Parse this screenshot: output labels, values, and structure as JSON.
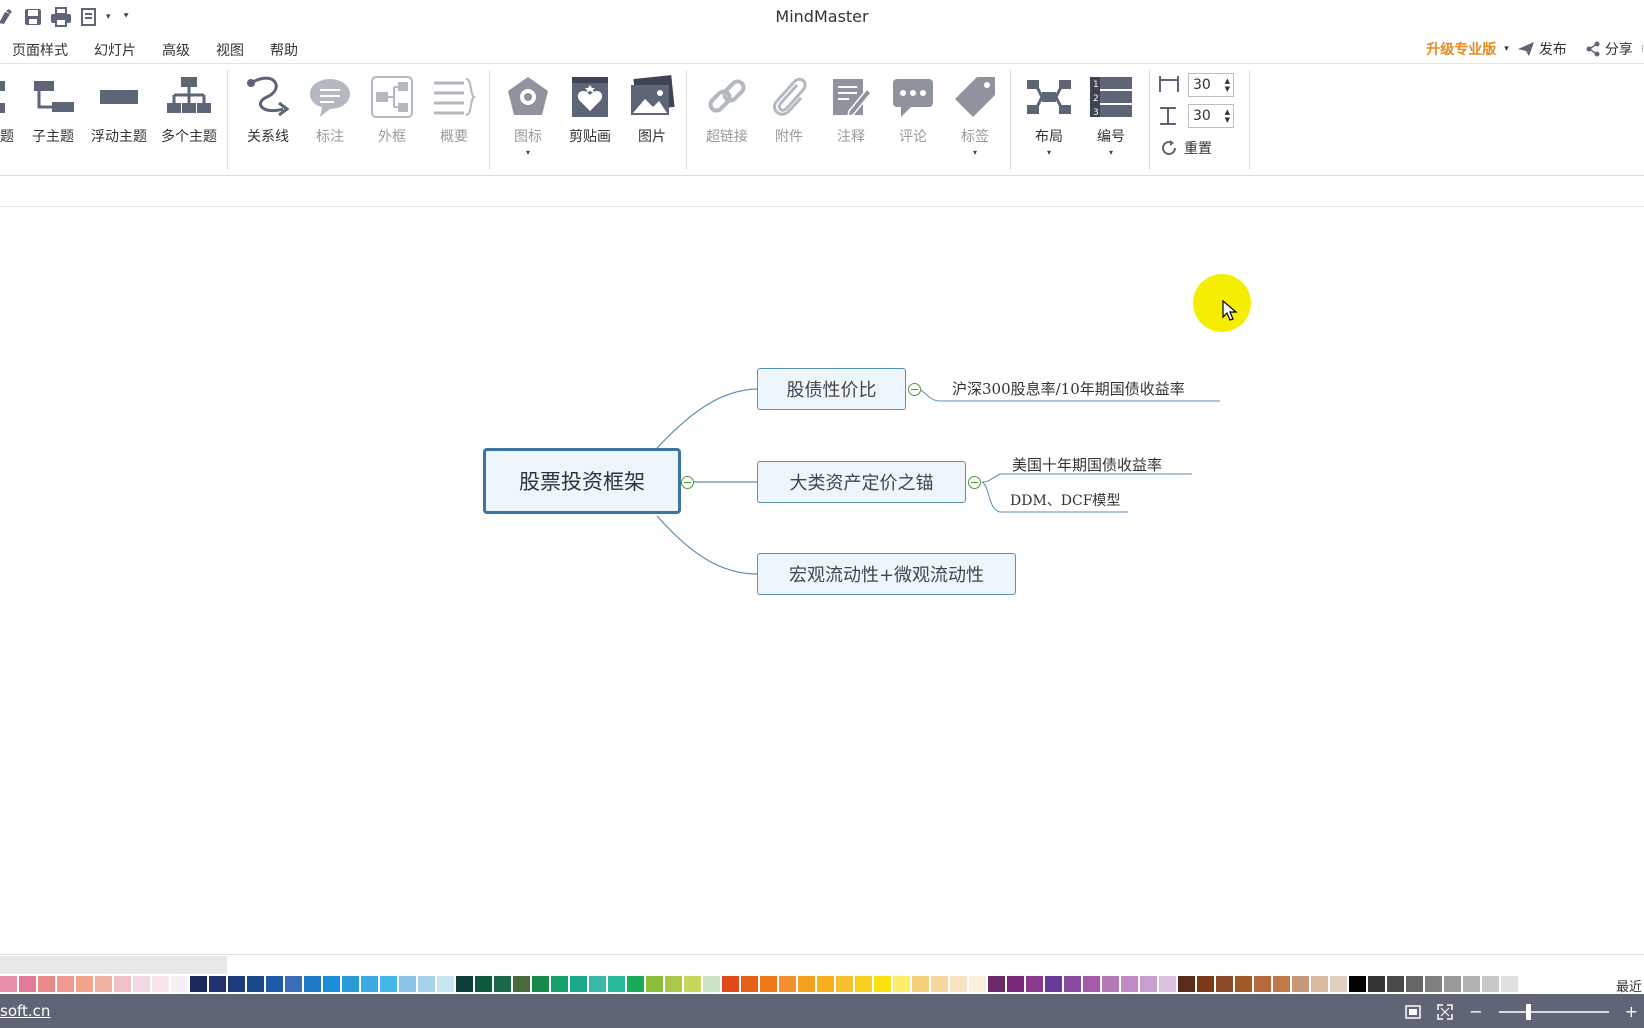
{
  "app": {
    "title": "MindMaster"
  },
  "quick_access": {
    "icons": [
      "brush-icon",
      "save-icon",
      "print-icon",
      "export-icon",
      "customize-dropdown-icon"
    ]
  },
  "menu": {
    "items": [
      "页面样式",
      "幻灯片",
      "高级",
      "视图",
      "帮助"
    ],
    "upgrade": "升级专业版",
    "publish": "发布",
    "share": "分享"
  },
  "ribbon": {
    "topic_partial_label": "题",
    "subtopic": "子主题",
    "floating_topic": "浮动主题",
    "multiple_topics": "多个主题",
    "relationship": "关系线",
    "callout": "标注",
    "boundary": "外框",
    "summary": "概要",
    "icon_label": "图标",
    "clipart": "剪贴画",
    "picture": "图片",
    "hyperlink": "超链接",
    "attachment": "附件",
    "note": "注释",
    "comment": "评论",
    "tag": "标签",
    "layout": "布局",
    "numbering": "编号",
    "h_spacing": "30",
    "v_spacing": "30",
    "reset": "重置"
  },
  "mindmap": {
    "central": "股票投资框架",
    "topics": [
      {
        "label": "股债性价比",
        "subtopics": [
          "沪深300股息率/10年期国债收益率"
        ]
      },
      {
        "label": "大类资产定价之锚",
        "subtopics": [
          "美国十年期国债收益率",
          "DDM、DCF模型"
        ]
      },
      {
        "label": "宏观流动性+微观流动性",
        "subtopics": []
      }
    ]
  },
  "palette": {
    "colors": [
      "#e88fa8",
      "#e27b98",
      "#e88a8a",
      "#ee9a8e",
      "#f2a48c",
      "#f0b2a4",
      "#f0c2c8",
      "#f0d8e4",
      "#fbe6ee",
      "#f5eef4",
      "#1a2a5a",
      "#22306e",
      "#1e3a7a",
      "#1b4a8c",
      "#1f5aa6",
      "#3a6db8",
      "#1e7ac6",
      "#1a8cd8",
      "#2a9ad8",
      "#3aaae0",
      "#44b6e8",
      "#8cc4e8",
      "#a8d2ec",
      "#c8e6f2",
      "#0f3e3a",
      "#0f5a3e",
      "#1a6a4a",
      "#4a6a3a",
      "#1a8a4a",
      "#1aa06a",
      "#1aa88a",
      "#3ab8a8",
      "#2ab89a",
      "#1aaa5a",
      "#8abe3a",
      "#a8c84a",
      "#c8d85a",
      "#cce4c4",
      "#e04a1a",
      "#e8601a",
      "#ee7a1a",
      "#f09030",
      "#f4a020",
      "#f8b020",
      "#f8c030",
      "#fad020",
      "#fce010",
      "#fcec6a",
      "#f2d07a",
      "#f4d8a0",
      "#f8e4c4",
      "#fbeedc",
      "#6a2a6a",
      "#7a2a7a",
      "#8a3a8a",
      "#6a3a9a",
      "#8a4aa0",
      "#a45aa8",
      "#b47ab8",
      "#c48ac8",
      "#c8a0d0",
      "#dcc0e0",
      "#5a2a1a",
      "#7a3a1a",
      "#8a4a2a",
      "#a05a2a",
      "#b46a3a",
      "#c07a4a",
      "#c8987a",
      "#d8b8a0",
      "#e0d0c0",
      "#000000",
      "#333333",
      "#4a4a4a",
      "#666666",
      "#808080",
      "#999999",
      "#b0b0b0",
      "#c8c8c8",
      "#e0e0e0"
    ],
    "recent_label": "最近"
  },
  "status": {
    "link": "soft.cn"
  }
}
